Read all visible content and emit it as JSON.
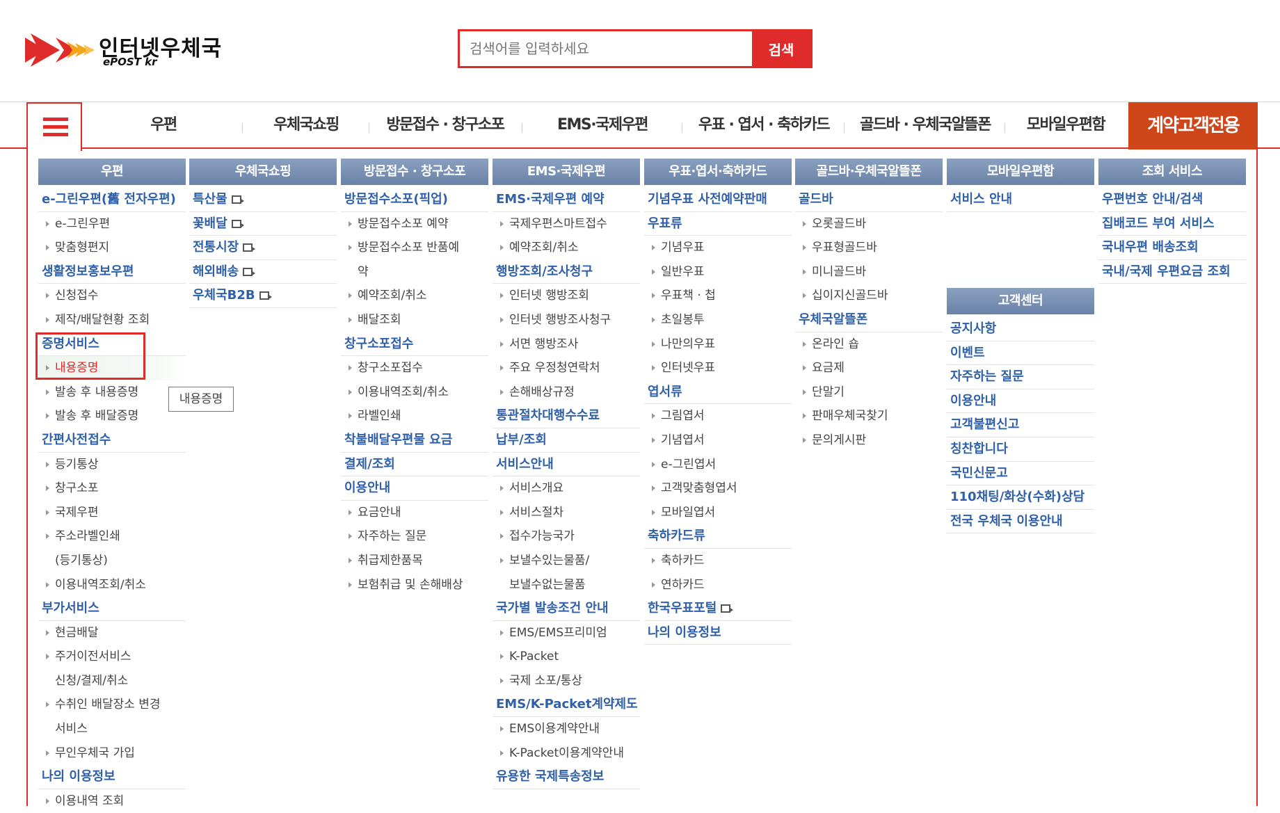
{
  "logo": {
    "kr": "인터넷우체국",
    "en": "ePOST kr"
  },
  "search": {
    "placeholder": "검색어를 입력하세요",
    "button": "검색"
  },
  "gnb": [
    "우편",
    "우체국쇼핑",
    "방문접수 · 창구소포",
    "EMS·국제우편",
    "우표 · 엽서 · 축하카드",
    "골드바 · 우체국알뜰폰",
    "모바일우편함"
  ],
  "gnb_contract": "계약고객전용",
  "tooltip": "내용증명",
  "columns": [
    {
      "title": "우편",
      "items": [
        {
          "t": "h",
          "text": "e-그린우편(舊 전자우편)"
        },
        {
          "t": "s",
          "text": "e-그린우편"
        },
        {
          "t": "s",
          "text": "맞춤형편지"
        },
        {
          "t": "h",
          "text": "생활정보홍보우편"
        },
        {
          "t": "s",
          "text": "신청접수"
        },
        {
          "t": "s",
          "text": "제작/배달현황 조회"
        },
        {
          "t": "h",
          "text": "증명서비스"
        },
        {
          "t": "s",
          "text": "내용증명",
          "active": true
        },
        {
          "t": "s",
          "text": "발송 후 내용증명"
        },
        {
          "t": "s",
          "text": "발송 후 배달증명"
        },
        {
          "t": "h",
          "text": "간편사전접수"
        },
        {
          "t": "s",
          "text": "등기통상"
        },
        {
          "t": "s",
          "text": "창구소포"
        },
        {
          "t": "s",
          "text": "국제우편"
        },
        {
          "t": "s",
          "text": "주소라벨인쇄"
        },
        {
          "t": "c",
          "text": "(등기통상)"
        },
        {
          "t": "s",
          "text": "이용내역조회/취소"
        },
        {
          "t": "h",
          "text": "부가서비스"
        },
        {
          "t": "s",
          "text": "현금배달"
        },
        {
          "t": "s",
          "text": "주거이전서비스"
        },
        {
          "t": "c",
          "text": "신청/결제/취소"
        },
        {
          "t": "s",
          "text": "수취인 배달장소 변경"
        },
        {
          "t": "c",
          "text": "서비스"
        },
        {
          "t": "s",
          "text": "무인우체국 가입"
        },
        {
          "t": "h",
          "text": "나의 이용정보"
        },
        {
          "t": "s",
          "text": "이용내역 조회"
        }
      ]
    },
    {
      "title": "우체국쇼핑",
      "items": [
        {
          "t": "h",
          "text": "특산물",
          "ext": true
        },
        {
          "t": "h",
          "text": "꽃배달",
          "ext": true
        },
        {
          "t": "h",
          "text": "전통시장",
          "ext": true
        },
        {
          "t": "h",
          "text": "해외배송",
          "ext": true
        },
        {
          "t": "h",
          "text": "우체국B2B",
          "ext": true
        }
      ]
    },
    {
      "title": "방문접수 · 창구소포",
      "items": [
        {
          "t": "h",
          "text": "방문접수소포(픽업)"
        },
        {
          "t": "s",
          "text": "방문접수소포 예약"
        },
        {
          "t": "s",
          "text": "방문접수소포 반품예"
        },
        {
          "t": "c",
          "text": "약"
        },
        {
          "t": "s",
          "text": "예약조회/취소"
        },
        {
          "t": "s",
          "text": "배달조회"
        },
        {
          "t": "h",
          "text": "창구소포접수"
        },
        {
          "t": "s",
          "text": "창구소포접수"
        },
        {
          "t": "s",
          "text": "이용내역조회/취소"
        },
        {
          "t": "s",
          "text": "라벨인쇄"
        },
        {
          "t": "h",
          "text": "착불배달우편물 요금"
        },
        {
          "t": "h",
          "text": "결제/조회"
        },
        {
          "t": "h",
          "text": "이용안내"
        },
        {
          "t": "s",
          "text": "요금안내"
        },
        {
          "t": "s",
          "text": "자주하는 질문"
        },
        {
          "t": "s",
          "text": "취급제한품목"
        },
        {
          "t": "s",
          "text": "보험취급 및 손해배상"
        }
      ]
    },
    {
      "title": "EMS·국제우편",
      "items": [
        {
          "t": "h",
          "text": "EMS·국제우편 예약"
        },
        {
          "t": "s",
          "text": "국제우편스마트접수"
        },
        {
          "t": "s",
          "text": "예약조회/취소"
        },
        {
          "t": "h",
          "text": "행방조회/조사청구"
        },
        {
          "t": "s",
          "text": "인터넷 행방조회"
        },
        {
          "t": "s",
          "text": "인터넷 행방조사청구"
        },
        {
          "t": "s",
          "text": "서면 행방조사"
        },
        {
          "t": "s",
          "text": "주요 우정청연락처"
        },
        {
          "t": "s",
          "text": "손해배상규정"
        },
        {
          "t": "h",
          "text": "통관절차대행수수료"
        },
        {
          "t": "h",
          "text": "납부/조회"
        },
        {
          "t": "h",
          "text": "서비스안내"
        },
        {
          "t": "s",
          "text": "서비스개요"
        },
        {
          "t": "s",
          "text": "서비스절차"
        },
        {
          "t": "s",
          "text": "접수가능국가"
        },
        {
          "t": "s",
          "text": "보낼수있는물품/"
        },
        {
          "t": "c",
          "text": "보낼수없는물품"
        },
        {
          "t": "h",
          "text": "국가별 발송조건 안내"
        },
        {
          "t": "s",
          "text": "EMS/EMS프리미엄"
        },
        {
          "t": "s",
          "text": "K-Packet"
        },
        {
          "t": "s",
          "text": "국제 소포/통상"
        },
        {
          "t": "h",
          "text": "EMS/K-Packet계약제도"
        },
        {
          "t": "s",
          "text": "EMS이용계약안내"
        },
        {
          "t": "s",
          "text": "K-Packet이용계약안내"
        },
        {
          "t": "h",
          "text": "유용한 국제특송정보"
        }
      ]
    },
    {
      "title": "우표·엽서·축하카드",
      "items": [
        {
          "t": "h",
          "text": "기념우표 사전예약판매"
        },
        {
          "t": "h",
          "text": "우표류"
        },
        {
          "t": "s",
          "text": "기념우표"
        },
        {
          "t": "s",
          "text": "일반우표"
        },
        {
          "t": "s",
          "text": "우표책 · 첩"
        },
        {
          "t": "s",
          "text": "초일봉투"
        },
        {
          "t": "s",
          "text": "나만의우표"
        },
        {
          "t": "s",
          "text": "인터넷우표"
        },
        {
          "t": "h",
          "text": "엽서류"
        },
        {
          "t": "s",
          "text": "그림엽서"
        },
        {
          "t": "s",
          "text": "기념엽서"
        },
        {
          "t": "s",
          "text": "e-그린엽서"
        },
        {
          "t": "s",
          "text": "고객맞춤형엽서"
        },
        {
          "t": "s",
          "text": "모바일엽서"
        },
        {
          "t": "h",
          "text": "축하카드류"
        },
        {
          "t": "s",
          "text": "축하카드"
        },
        {
          "t": "s",
          "text": "연하카드"
        },
        {
          "t": "h",
          "text": "한국우표포털",
          "ext": true
        },
        {
          "t": "h",
          "text": "나의 이용정보"
        }
      ]
    },
    {
      "title": "골드바·우체국알뜰폰",
      "items": [
        {
          "t": "h",
          "text": "골드바"
        },
        {
          "t": "s",
          "text": "오롯골드바"
        },
        {
          "t": "s",
          "text": "우표형골드바"
        },
        {
          "t": "s",
          "text": "미니골드바"
        },
        {
          "t": "s",
          "text": "십이지신골드바"
        },
        {
          "t": "h",
          "text": "우체국알뜰폰"
        },
        {
          "t": "s",
          "text": "온라인 숍"
        },
        {
          "t": "s",
          "text": "요금제"
        },
        {
          "t": "s",
          "text": "단말기"
        },
        {
          "t": "s",
          "text": "판매우체국찾기"
        },
        {
          "t": "s",
          "text": "문의게시판"
        }
      ]
    },
    {
      "title": "모바일우편함",
      "items": [
        {
          "t": "h",
          "text": "서비스 안내"
        }
      ]
    },
    {
      "title": "조회 서비스",
      "items": [
        {
          "t": "h",
          "text": "우편번호 안내/검색"
        },
        {
          "t": "h",
          "text": "집배코드 부여 서비스"
        },
        {
          "t": "h",
          "text": "국내우편 배송조회"
        },
        {
          "t": "h",
          "text": "국내/국제 우편요금 조회"
        }
      ]
    },
    {
      "title": "고객센터",
      "items": [
        {
          "t": "h",
          "text": "공지사항"
        },
        {
          "t": "h",
          "text": "이벤트"
        },
        {
          "t": "h",
          "text": "자주하는 질문"
        },
        {
          "t": "h",
          "text": "이용안내"
        },
        {
          "t": "h",
          "text": "고객불편신고"
        },
        {
          "t": "h",
          "text": "칭찬합니다"
        },
        {
          "t": "h",
          "text": "국민신문고"
        },
        {
          "t": "h",
          "text": "110채팅/화상(수화)상담"
        },
        {
          "t": "h",
          "text": "전국 우체국 이용안내"
        }
      ]
    }
  ]
}
